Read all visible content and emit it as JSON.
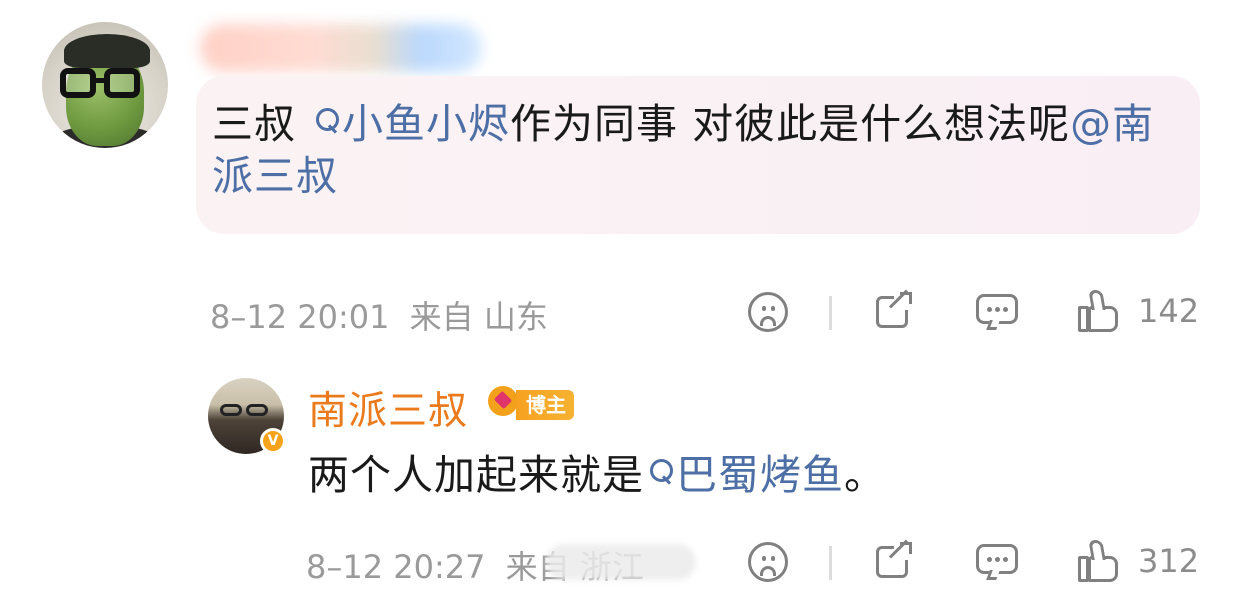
{
  "comment": {
    "username_blurred": "",
    "text_prefix": "三叔 ",
    "topic_link": "小鱼小烬",
    "text_middle": "作为同事 对彼此是什么想法呢",
    "mention": "@南派三叔",
    "date": "8–12 20:01",
    "location": "来自 山东",
    "like_count": "142"
  },
  "reply": {
    "username": "南派三叔",
    "verified_badge": "V",
    "role_tag": "博主",
    "text_prefix": "两个人加起来就是",
    "topic_link": "巴蜀烤鱼",
    "text_suffix": "。",
    "date": "8–12 20:27",
    "location": "来自 浙江",
    "like_count": "312"
  },
  "colors": {
    "link": "#4d6fa6",
    "author_name": "#eb7a1c",
    "meta_gray": "#9a9a9a",
    "icon_gray": "#808080",
    "bubble_pink": "#f9f1f4"
  },
  "icons": [
    "search-topic-icon",
    "sad-face-icon",
    "share-icon",
    "comment-icon",
    "thumbs-up-icon",
    "crown-icon",
    "verified-badge-icon"
  ]
}
